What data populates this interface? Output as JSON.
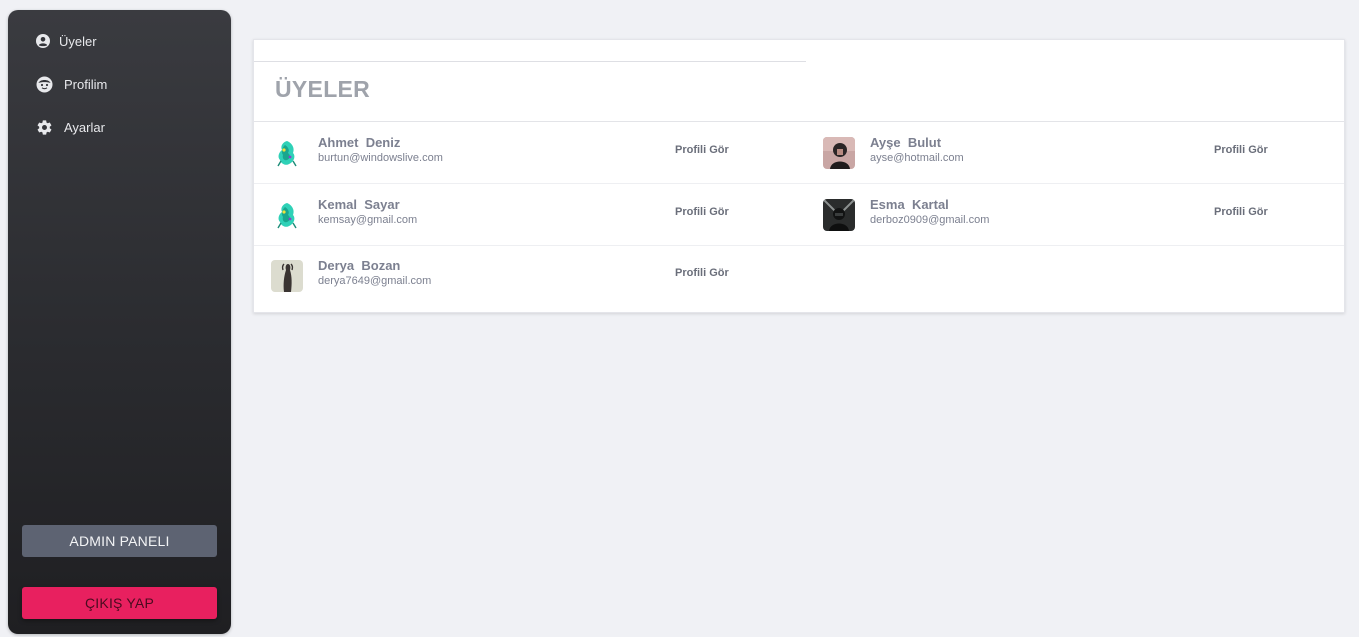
{
  "sidebar": {
    "items": [
      {
        "label": "Üyeler",
        "icon": "user-circle-icon"
      },
      {
        "label": "Profilim",
        "icon": "face-icon"
      },
      {
        "label": "Ayarlar",
        "icon": "gear-icon"
      }
    ],
    "admin_label": "ADMIN PANELI",
    "logout_label": "ÇIKIŞ YAP"
  },
  "main": {
    "title": "ÜYELER",
    "view_profile_label": "Profili Gör",
    "members": [
      {
        "first": "Ahmet",
        "last": "Deniz",
        "email": "burtun@windowslive.com",
        "avatar": "abstract-teal"
      },
      {
        "first": "Ayşe",
        "last": "Bulut",
        "email": "ayse@hotmail.com",
        "avatar": "photo-pink"
      },
      {
        "first": "Kemal",
        "last": "Sayar",
        "email": "kemsay@gmail.com",
        "avatar": "abstract-teal"
      },
      {
        "first": "Esma",
        "last": "Kartal",
        "email": "derboz0909@gmail.com",
        "avatar": "photo-dark"
      },
      {
        "first": "Derya",
        "last": "Bozan",
        "email": "derya7649@gmail.com",
        "avatar": "photo-beige"
      }
    ]
  },
  "colors": {
    "sidebar_bg": "#2e2f33",
    "admin_button": "#5d6372",
    "logout_button": "#e8205f",
    "page_bg": "#f0f1f5"
  }
}
